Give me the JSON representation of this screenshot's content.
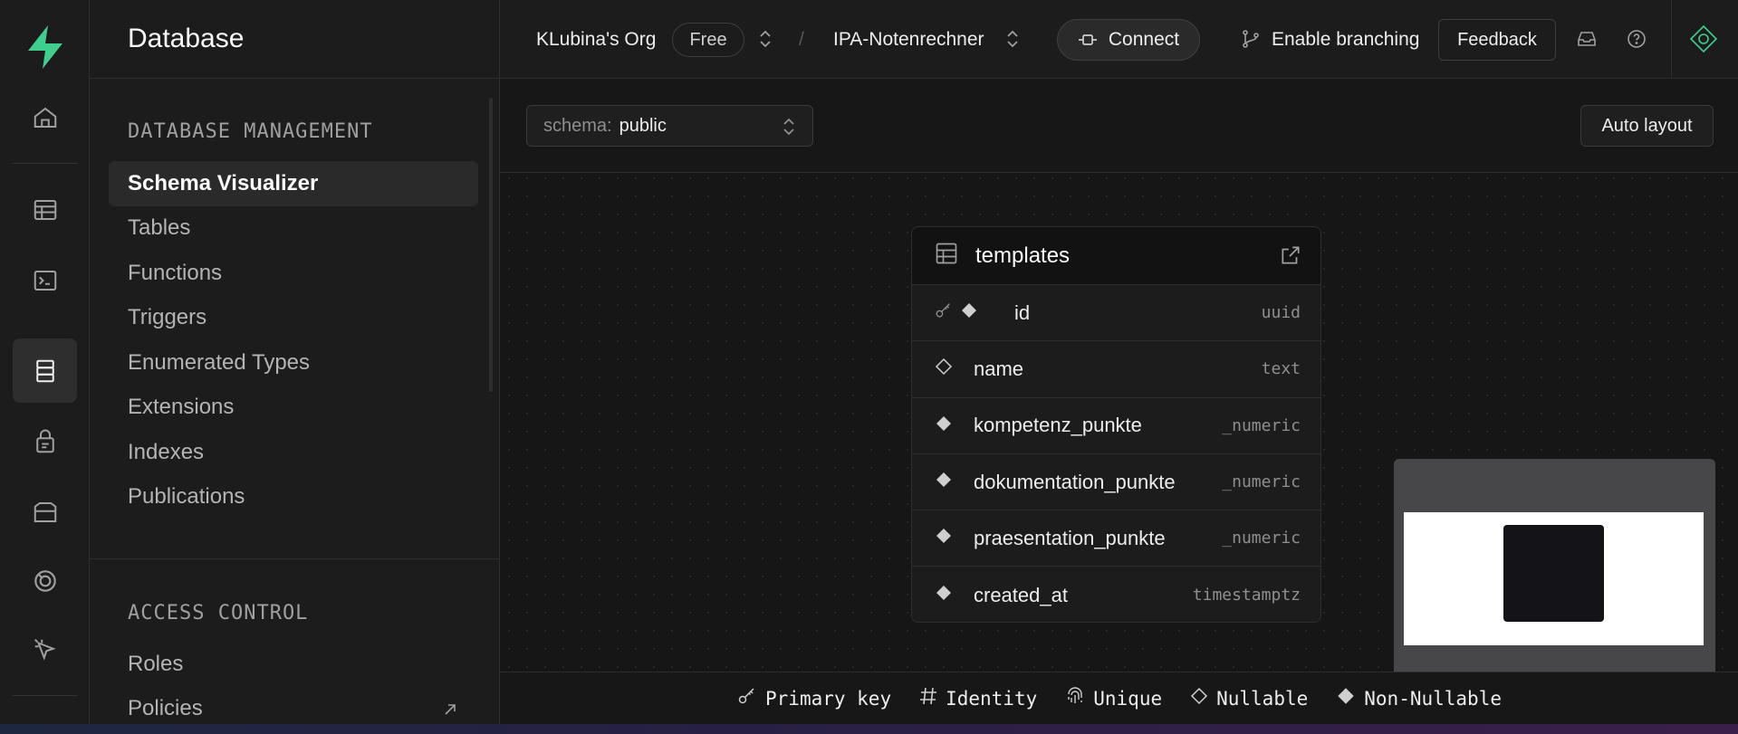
{
  "topbar": {
    "org": "KLubina's Org",
    "plan": "Free",
    "separator": "/",
    "project": "IPA-Notenrechner",
    "connect_label": "Connect",
    "branching_label": "Enable branching",
    "feedback_label": "Feedback"
  },
  "sidebar": {
    "title": "Database",
    "section_management": "DATABASE MANAGEMENT",
    "management_items": [
      {
        "label": "Schema Visualizer",
        "active": true
      },
      {
        "label": "Tables"
      },
      {
        "label": "Functions"
      },
      {
        "label": "Triggers"
      },
      {
        "label": "Enumerated Types"
      },
      {
        "label": "Extensions"
      },
      {
        "label": "Indexes"
      },
      {
        "label": "Publications"
      }
    ],
    "section_access": "ACCESS CONTROL",
    "access_items": [
      {
        "label": "Roles"
      },
      {
        "label": "Policies"
      }
    ]
  },
  "rail": {
    "icons": [
      "supabase-logo-icon",
      "home-icon",
      "table-editor-icon",
      "sql-editor-icon",
      "database-icon",
      "auth-icon",
      "storage-icon",
      "realtime-icon",
      "cursor-icon"
    ]
  },
  "canvas": {
    "schema_label": "schema:",
    "schema_value": "public",
    "auto_layout_label": "Auto layout"
  },
  "table": {
    "name": "templates",
    "columns": [
      {
        "name": "id",
        "type": "uuid",
        "primary": true,
        "nullable": false
      },
      {
        "name": "name",
        "type": "text",
        "primary": false,
        "nullable": true
      },
      {
        "name": "kompetenz_punkte",
        "type": "_numeric",
        "primary": false,
        "nullable": false
      },
      {
        "name": "dokumentation_punkte",
        "type": "_numeric",
        "primary": false,
        "nullable": false
      },
      {
        "name": "praesentation_punkte",
        "type": "_numeric",
        "primary": false,
        "nullable": false
      },
      {
        "name": "created_at",
        "type": "timestamptz",
        "primary": false,
        "nullable": false
      }
    ]
  },
  "legend": {
    "primary_key": "Primary key",
    "identity": "Identity",
    "unique": "Unique",
    "nullable": "Nullable",
    "non_nullable": "Non-Nullable"
  },
  "colors": {
    "brand": "#3ecf8e",
    "bg": "#171717",
    "panel": "#1c1c1c",
    "border": "#2e2e2e"
  }
}
